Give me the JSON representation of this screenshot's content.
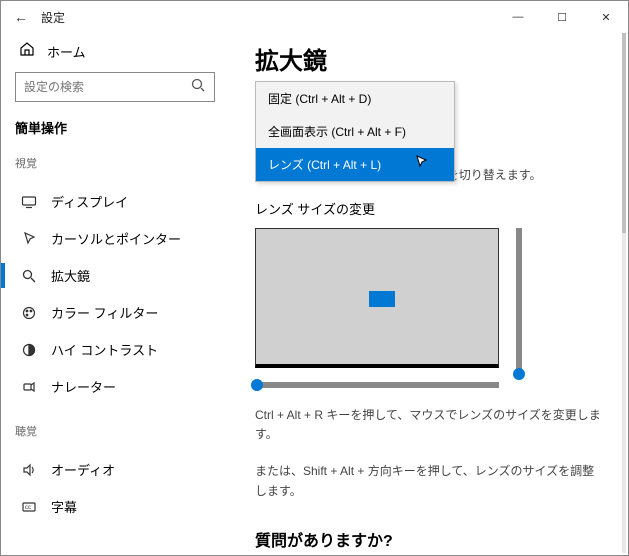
{
  "window": {
    "title": "設定",
    "back_icon": "←",
    "min": "—",
    "max": "☐",
    "close": "✕"
  },
  "sidebar": {
    "home": "ホーム",
    "search_placeholder": "設定の検索",
    "section": "簡単操作",
    "cat_vision": "視覚",
    "cat_hearing": "聴覚",
    "items": [
      {
        "label": "ディスプレイ"
      },
      {
        "label": "カーソルとポインター"
      },
      {
        "label": "拡大鏡"
      },
      {
        "label": "カラー フィルター"
      },
      {
        "label": "ハイ コントラスト"
      },
      {
        "label": "ナレーター"
      }
    ],
    "hearing_items": [
      {
        "label": "オーディオ"
      },
      {
        "label": "字幕"
      }
    ]
  },
  "main": {
    "heading": "拡大鏡",
    "dropdown": {
      "opt0": "固定 (Ctrl + Alt + D)",
      "opt1": "全画面表示 (Ctrl + Alt + F)",
      "opt2": "レンズ (Ctrl + Alt + L)"
    },
    "hint_switch": "Ctrl + Alt + M キーを押して、ビューを切り替えます。",
    "lens_heading": "レンズ サイズの変更",
    "hint_resize1": "Ctrl + Alt + R キーを押して、マウスでレンズのサイズを変更します。",
    "hint_resize2": "または、Shift + Alt + 方向キーを押して、レンズのサイズを調整します。",
    "question": "質問がありますか?"
  }
}
